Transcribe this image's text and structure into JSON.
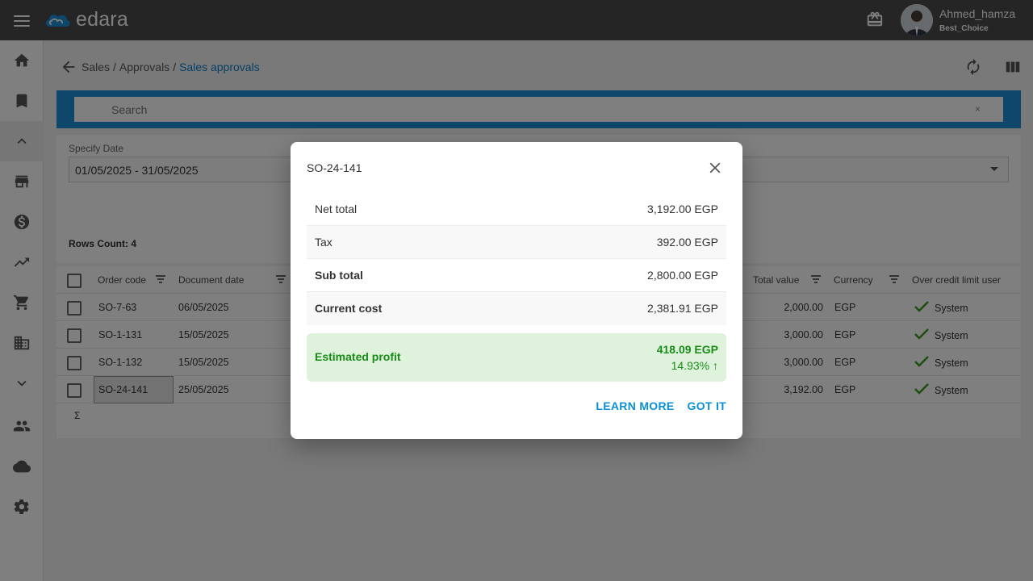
{
  "app": {
    "brand": "edara"
  },
  "user": {
    "name": "Ahmed_hamza",
    "company": "Best_Choice"
  },
  "icons": {
    "menu": "hamburger-icon",
    "logo": "edara-cloud-logo",
    "gift": "gift-icon",
    "home": "home-icon",
    "bookmark": "bookmark-icon",
    "collapse": "chevron-up-icon",
    "store": "store-icon",
    "money": "dollar-icon",
    "trend": "trending-up-icon",
    "cart": "cart-icon",
    "building": "building-icon",
    "expand": "chevron-down-icon",
    "people": "people-icon",
    "cloud": "cloud-icon",
    "settings": "gear-icon",
    "back": "arrow-back-icon",
    "refresh": "refresh-icon",
    "columns": "columns-icon",
    "close": "close-icon",
    "check": "check-icon"
  },
  "breadcrumb": {
    "level1": "Sales",
    "level2": "Approvals",
    "current": "Sales approvals",
    "separator": "/"
  },
  "search": {
    "placeholder": "Search",
    "clear": "×"
  },
  "filters": {
    "date_label": "Specify Date",
    "date_value": "01/05/2025 - 31/05/2025",
    "rows_count": "Rows Count: 4"
  },
  "grid": {
    "columns": {
      "order_code": "Order code",
      "document_date": "Document date",
      "total_value": "Total value",
      "currency": "Currency",
      "over_credit": "Over credit limit user"
    },
    "rows": [
      {
        "order_code": "SO-7-63",
        "document_date": "06/05/2025",
        "total_value": "2,000.00",
        "currency": "EGP",
        "user": "System"
      },
      {
        "order_code": "SO-1-131",
        "document_date": "15/05/2025",
        "total_value": "3,000.00",
        "currency": "EGP",
        "user": "System"
      },
      {
        "order_code": "SO-1-132",
        "document_date": "15/05/2025",
        "total_value": "3,000.00",
        "currency": "EGP",
        "user": "System"
      },
      {
        "order_code": "SO-24-141",
        "document_date": "25/05/2025",
        "total_value": "3,192.00",
        "currency": "EGP",
        "user": "System"
      }
    ],
    "sum_symbol": "Σ"
  },
  "dialog": {
    "title": "SO-24-141",
    "rows": [
      {
        "label": "Net total",
        "value": "3,192.00 EGP"
      },
      {
        "label": "Tax",
        "value": "392.00 EGP"
      },
      {
        "label": "Sub total",
        "value": "2,800.00 EGP"
      },
      {
        "label": "Current cost",
        "value": "2,381.91 EGP"
      }
    ],
    "profit": {
      "label": "Estimated profit",
      "amount": "418.09 EGP",
      "percent": "14.93% ↑"
    },
    "learn_more": "LEARN MORE",
    "got_it": "GOT IT"
  },
  "colors": {
    "topbar": "#4a4a4a",
    "accent": "#1e8fd6",
    "link": "#0b7fc7",
    "profit_bg": "#dff3dc",
    "profit_text": "#1a8c1a",
    "check": "#3a9a1e"
  }
}
